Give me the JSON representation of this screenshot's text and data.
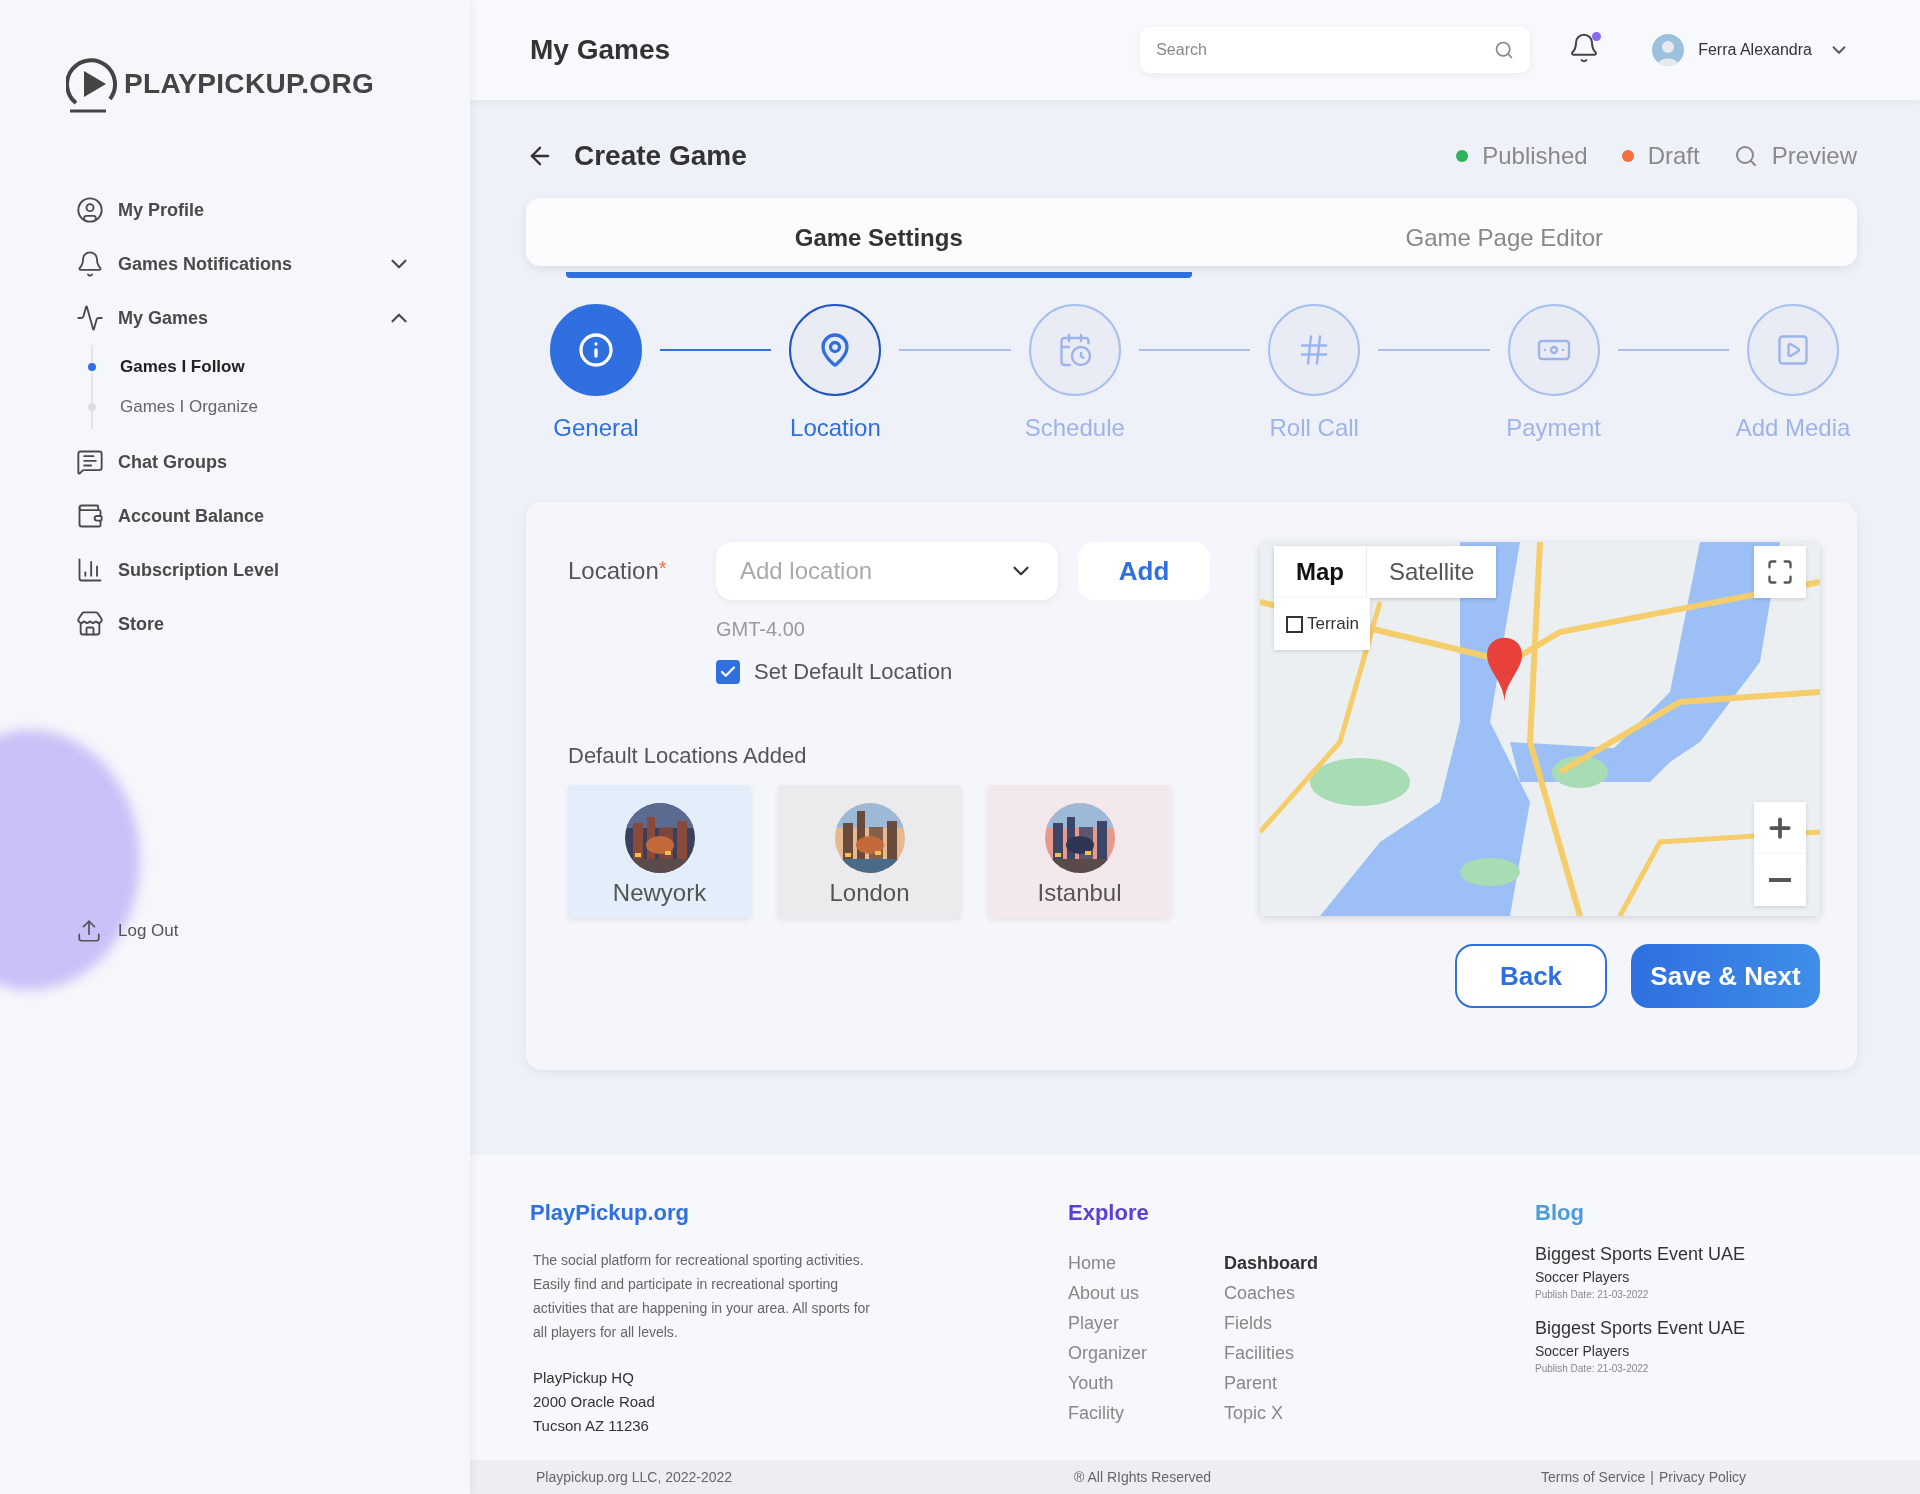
{
  "logo": {
    "text": "PLAYPICKUP.ORG"
  },
  "sidebar": {
    "items": [
      {
        "label": "My Profile"
      },
      {
        "label": "Games Notifications",
        "expanded": false
      },
      {
        "label": "My Games",
        "expanded": true,
        "children": [
          {
            "label": "Games I Follow",
            "selected": true
          },
          {
            "label": "Games I Organize",
            "selected": false
          }
        ]
      },
      {
        "label": "Chat Groups"
      },
      {
        "label": "Account Balance"
      },
      {
        "label": "Subscription Level"
      },
      {
        "label": "Store"
      }
    ],
    "logout": "Log Out"
  },
  "header": {
    "title": "My Games",
    "search": {
      "placeholder": "Search"
    },
    "notifications": {
      "unread": true
    },
    "user": {
      "name": "Ferra Alexandra"
    }
  },
  "page": {
    "title": "Create Game",
    "statuses": [
      {
        "label": "Published",
        "color": "#2fb35a"
      },
      {
        "label": "Draft",
        "color": "#f1703d"
      }
    ],
    "preview": "Preview"
  },
  "tabs": [
    {
      "label": "Game Settings",
      "selected": true
    },
    {
      "label": "Game Page Editor",
      "selected": false
    }
  ],
  "steps": [
    {
      "label": "General",
      "completed": true,
      "selected": false
    },
    {
      "label": "Location",
      "completed": false,
      "selected": true
    },
    {
      "label": "Schedule",
      "completed": false,
      "selected": false
    },
    {
      "label": "Roll Call",
      "completed": false,
      "selected": false
    },
    {
      "label": "Payment",
      "completed": false,
      "selected": false
    },
    {
      "label": "Add Media",
      "completed": false,
      "selected": false
    }
  ],
  "form": {
    "location_label": "Location",
    "required_mark": "*",
    "placeholder": "Add location",
    "add_button": "Add",
    "timezone": "GMT-4.00",
    "default_checkbox": {
      "label": "Set Default Location",
      "checked": true
    },
    "defaults_title": "Default Locations Added",
    "defaults": [
      {
        "label": "Newyork",
        "color": "#e3eefa"
      },
      {
        "label": "London",
        "color": "#ebebed"
      },
      {
        "label": "Istanbul",
        "color": "#f3e8ec"
      }
    ]
  },
  "map": {
    "map_types": [
      {
        "label": "Map",
        "selected": true
      },
      {
        "label": "Satellite",
        "selected": false
      }
    ],
    "terrain": {
      "label": "Terrain",
      "checked": false
    }
  },
  "actions": {
    "back": "Back",
    "next": "Save & Next"
  },
  "footer": {
    "brand": {
      "title": "PlayPickup.org",
      "description": "The social platform for recreational sporting activities. Easily find and participate in recreational sporting activities that are happening in your area. All sports for all players for all levels.",
      "address": [
        "PlayPickup HQ",
        "2000 Oracle Road",
        "Tucson AZ 11236"
      ]
    },
    "explore": {
      "title": "Explore",
      "columns": [
        [
          {
            "label": "Home",
            "selected": false
          },
          {
            "label": "About us",
            "selected": false
          },
          {
            "label": "Player",
            "selected": false
          },
          {
            "label": "Organizer",
            "selected": false
          },
          {
            "label": "Youth",
            "selected": false
          },
          {
            "label": "Facility",
            "selected": false
          }
        ],
        [
          {
            "label": "Dashboard",
            "selected": true
          },
          {
            "label": "Coaches",
            "selected": false
          },
          {
            "label": "Fields",
            "selected": false
          },
          {
            "label": "Facilities",
            "selected": false
          },
          {
            "label": "Parent",
            "selected": false
          },
          {
            "label": "Topic X",
            "selected": false
          }
        ]
      ]
    },
    "blog": {
      "title": "Blog",
      "posts": [
        {
          "title": "Biggest Sports Event UAE",
          "subtitle": "Soccer Players",
          "date": "Publish Date: 21-03-2022"
        },
        {
          "title": "Biggest Sports Event UAE",
          "subtitle": "Soccer Players",
          "date": "Publish Date: 21-03-2022"
        }
      ]
    },
    "copyright": "Playpickup.org LLC, 2022-2022",
    "rights": "® All RIghts Reserved",
    "legal": [
      "Terms of Service",
      "Privacy Policy"
    ],
    "legal_separator": "|"
  }
}
